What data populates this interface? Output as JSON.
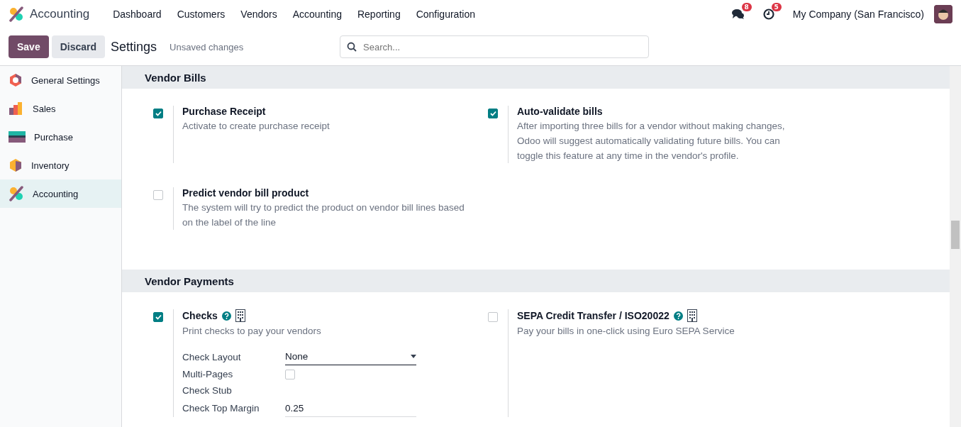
{
  "navbar": {
    "app_name": "Accounting",
    "menu": [
      "Dashboard",
      "Customers",
      "Vendors",
      "Accounting",
      "Reporting",
      "Configuration"
    ],
    "messages_badge": "8",
    "activities_badge": "5",
    "company": "My Company (San Francisco)"
  },
  "control_panel": {
    "save": "Save",
    "discard": "Discard",
    "title": "Settings",
    "status": "Unsaved changes",
    "search": {
      "placeholder": "Search..."
    }
  },
  "sidebar": {
    "items": [
      {
        "label": "General Settings",
        "selected": false
      },
      {
        "label": "Sales",
        "selected": false
      },
      {
        "label": "Purchase",
        "selected": false
      },
      {
        "label": "Inventory",
        "selected": false
      },
      {
        "label": "Accounting",
        "selected": true
      }
    ]
  },
  "sections": [
    {
      "title": "Vendor Bills",
      "settings": [
        {
          "title": "Purchase Receipt",
          "checked": true,
          "help": false,
          "company": false,
          "description": "Activate to create purchase receipt"
        },
        {
          "title": "Auto-validate bills",
          "checked": true,
          "help": false,
          "company": false,
          "description": "After importing three bills for a vendor without making changes, Odoo will suggest automatically validating future bills. You can toggle this feature at any time in the vendor's profile."
        },
        {
          "title": "Predict vendor bill product",
          "checked": false,
          "help": false,
          "company": false,
          "description": "The system will try to predict the product on vendor bill lines based on the label of the line"
        }
      ]
    },
    {
      "title": "Vendor Payments",
      "settings": [
        {
          "title": "Checks",
          "checked": true,
          "help": true,
          "company": true,
          "description": "Print checks to pay your vendors",
          "fields": [
            {
              "kind": "select",
              "label": "Check Layout",
              "value": "None"
            },
            {
              "kind": "checkbox",
              "label": "Multi-Pages",
              "checked": false
            },
            {
              "kind": "label",
              "label": "Check Stub"
            },
            {
              "kind": "input",
              "label": "Check Top Margin",
              "value": "0.25"
            }
          ]
        },
        {
          "title": "SEPA Credit Transfer / ISO20022",
          "checked": false,
          "help": true,
          "company": true,
          "description": "Pay your bills in one-click using Euro SEPA Service"
        }
      ]
    }
  ]
}
